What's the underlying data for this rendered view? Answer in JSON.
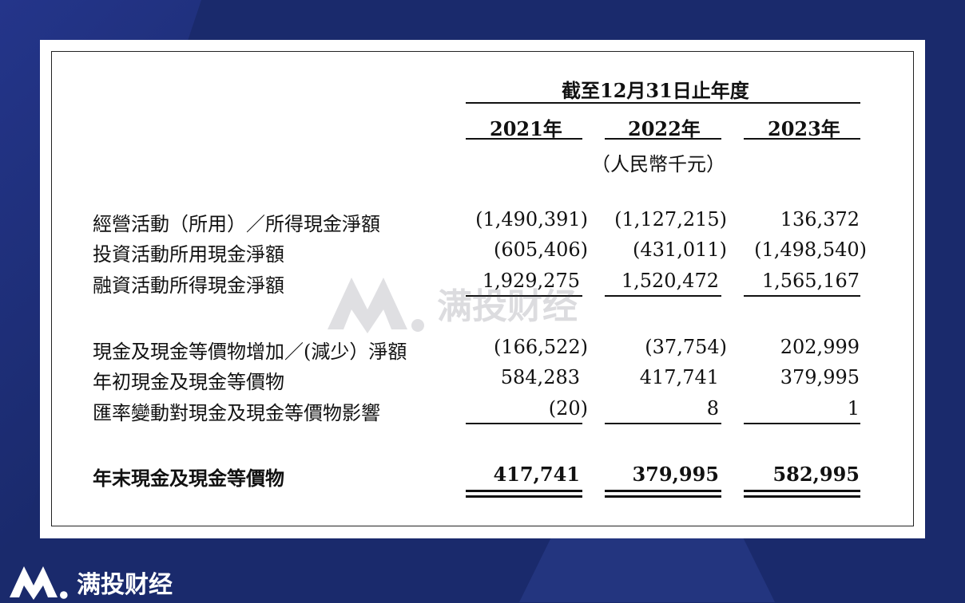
{
  "header": {
    "period_label": "截至12月31日止年度",
    "years": [
      "2021年",
      "2022年",
      "2023年"
    ],
    "unit": "（人民幣千元）"
  },
  "rows": [
    {
      "label": "經營活動（所用）／所得現金淨額",
      "values": [
        "(1,490,391)",
        "(1,127,215)",
        "136,372"
      ]
    },
    {
      "label": "投資活動所用現金淨額",
      "values": [
        "(605,406)",
        "(431,011)",
        "(1,498,540)"
      ]
    },
    {
      "label": "融資活動所得現金淨額",
      "values": [
        "1,929,275",
        "1,520,472",
        "1,565,167"
      ]
    },
    {
      "label": "現金及現金等價物增加／(減少）淨額",
      "values": [
        "(166,522)",
        "(37,754)",
        "202,999"
      ]
    },
    {
      "label": "年初現金及現金等價物",
      "values": [
        "584,283",
        "417,741",
        "379,995"
      ]
    },
    {
      "label": "匯率變動對現金及現金等價物影響",
      "values": [
        "(20)",
        "8",
        "1"
      ]
    },
    {
      "label": "年末現金及現金等價物",
      "values": [
        "417,741",
        "379,995",
        "582,995"
      ]
    }
  ],
  "watermark": {
    "text": "满投财经",
    "icon": "mountain-m-logo-icon"
  },
  "brand": {
    "text": "满投财经",
    "icon": "mountain-m-logo-icon"
  }
}
